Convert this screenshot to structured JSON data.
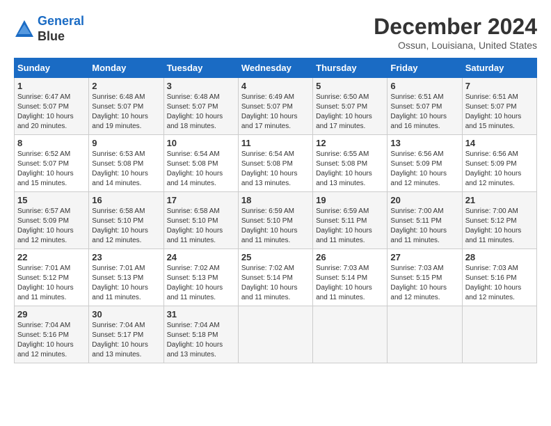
{
  "header": {
    "logo_line1": "General",
    "logo_line2": "Blue",
    "title": "December 2024",
    "location": "Ossun, Louisiana, United States"
  },
  "weekdays": [
    "Sunday",
    "Monday",
    "Tuesday",
    "Wednesday",
    "Thursday",
    "Friday",
    "Saturday"
  ],
  "weeks": [
    [
      {
        "day": "1",
        "sunrise": "Sunrise: 6:47 AM",
        "sunset": "Sunset: 5:07 PM",
        "daylight": "Daylight: 10 hours and 20 minutes."
      },
      {
        "day": "2",
        "sunrise": "Sunrise: 6:48 AM",
        "sunset": "Sunset: 5:07 PM",
        "daylight": "Daylight: 10 hours and 19 minutes."
      },
      {
        "day": "3",
        "sunrise": "Sunrise: 6:48 AM",
        "sunset": "Sunset: 5:07 PM",
        "daylight": "Daylight: 10 hours and 18 minutes."
      },
      {
        "day": "4",
        "sunrise": "Sunrise: 6:49 AM",
        "sunset": "Sunset: 5:07 PM",
        "daylight": "Daylight: 10 hours and 17 minutes."
      },
      {
        "day": "5",
        "sunrise": "Sunrise: 6:50 AM",
        "sunset": "Sunset: 5:07 PM",
        "daylight": "Daylight: 10 hours and 17 minutes."
      },
      {
        "day": "6",
        "sunrise": "Sunrise: 6:51 AM",
        "sunset": "Sunset: 5:07 PM",
        "daylight": "Daylight: 10 hours and 16 minutes."
      },
      {
        "day": "7",
        "sunrise": "Sunrise: 6:51 AM",
        "sunset": "Sunset: 5:07 PM",
        "daylight": "Daylight: 10 hours and 15 minutes."
      }
    ],
    [
      {
        "day": "8",
        "sunrise": "Sunrise: 6:52 AM",
        "sunset": "Sunset: 5:07 PM",
        "daylight": "Daylight: 10 hours and 15 minutes."
      },
      {
        "day": "9",
        "sunrise": "Sunrise: 6:53 AM",
        "sunset": "Sunset: 5:08 PM",
        "daylight": "Daylight: 10 hours and 14 minutes."
      },
      {
        "day": "10",
        "sunrise": "Sunrise: 6:54 AM",
        "sunset": "Sunset: 5:08 PM",
        "daylight": "Daylight: 10 hours and 14 minutes."
      },
      {
        "day": "11",
        "sunrise": "Sunrise: 6:54 AM",
        "sunset": "Sunset: 5:08 PM",
        "daylight": "Daylight: 10 hours and 13 minutes."
      },
      {
        "day": "12",
        "sunrise": "Sunrise: 6:55 AM",
        "sunset": "Sunset: 5:08 PM",
        "daylight": "Daylight: 10 hours and 13 minutes."
      },
      {
        "day": "13",
        "sunrise": "Sunrise: 6:56 AM",
        "sunset": "Sunset: 5:09 PM",
        "daylight": "Daylight: 10 hours and 12 minutes."
      },
      {
        "day": "14",
        "sunrise": "Sunrise: 6:56 AM",
        "sunset": "Sunset: 5:09 PM",
        "daylight": "Daylight: 10 hours and 12 minutes."
      }
    ],
    [
      {
        "day": "15",
        "sunrise": "Sunrise: 6:57 AM",
        "sunset": "Sunset: 5:09 PM",
        "daylight": "Daylight: 10 hours and 12 minutes."
      },
      {
        "day": "16",
        "sunrise": "Sunrise: 6:58 AM",
        "sunset": "Sunset: 5:10 PM",
        "daylight": "Daylight: 10 hours and 12 minutes."
      },
      {
        "day": "17",
        "sunrise": "Sunrise: 6:58 AM",
        "sunset": "Sunset: 5:10 PM",
        "daylight": "Daylight: 10 hours and 11 minutes."
      },
      {
        "day": "18",
        "sunrise": "Sunrise: 6:59 AM",
        "sunset": "Sunset: 5:10 PM",
        "daylight": "Daylight: 10 hours and 11 minutes."
      },
      {
        "day": "19",
        "sunrise": "Sunrise: 6:59 AM",
        "sunset": "Sunset: 5:11 PM",
        "daylight": "Daylight: 10 hours and 11 minutes."
      },
      {
        "day": "20",
        "sunrise": "Sunrise: 7:00 AM",
        "sunset": "Sunset: 5:11 PM",
        "daylight": "Daylight: 10 hours and 11 minutes."
      },
      {
        "day": "21",
        "sunrise": "Sunrise: 7:00 AM",
        "sunset": "Sunset: 5:12 PM",
        "daylight": "Daylight: 10 hours and 11 minutes."
      }
    ],
    [
      {
        "day": "22",
        "sunrise": "Sunrise: 7:01 AM",
        "sunset": "Sunset: 5:12 PM",
        "daylight": "Daylight: 10 hours and 11 minutes."
      },
      {
        "day": "23",
        "sunrise": "Sunrise: 7:01 AM",
        "sunset": "Sunset: 5:13 PM",
        "daylight": "Daylight: 10 hours and 11 minutes."
      },
      {
        "day": "24",
        "sunrise": "Sunrise: 7:02 AM",
        "sunset": "Sunset: 5:13 PM",
        "daylight": "Daylight: 10 hours and 11 minutes."
      },
      {
        "day": "25",
        "sunrise": "Sunrise: 7:02 AM",
        "sunset": "Sunset: 5:14 PM",
        "daylight": "Daylight: 10 hours and 11 minutes."
      },
      {
        "day": "26",
        "sunrise": "Sunrise: 7:03 AM",
        "sunset": "Sunset: 5:14 PM",
        "daylight": "Daylight: 10 hours and 11 minutes."
      },
      {
        "day": "27",
        "sunrise": "Sunrise: 7:03 AM",
        "sunset": "Sunset: 5:15 PM",
        "daylight": "Daylight: 10 hours and 12 minutes."
      },
      {
        "day": "28",
        "sunrise": "Sunrise: 7:03 AM",
        "sunset": "Sunset: 5:16 PM",
        "daylight": "Daylight: 10 hours and 12 minutes."
      }
    ],
    [
      {
        "day": "29",
        "sunrise": "Sunrise: 7:04 AM",
        "sunset": "Sunset: 5:16 PM",
        "daylight": "Daylight: 10 hours and 12 minutes."
      },
      {
        "day": "30",
        "sunrise": "Sunrise: 7:04 AM",
        "sunset": "Sunset: 5:17 PM",
        "daylight": "Daylight: 10 hours and 13 minutes."
      },
      {
        "day": "31",
        "sunrise": "Sunrise: 7:04 AM",
        "sunset": "Sunset: 5:18 PM",
        "daylight": "Daylight: 10 hours and 13 minutes."
      },
      null,
      null,
      null,
      null
    ]
  ]
}
